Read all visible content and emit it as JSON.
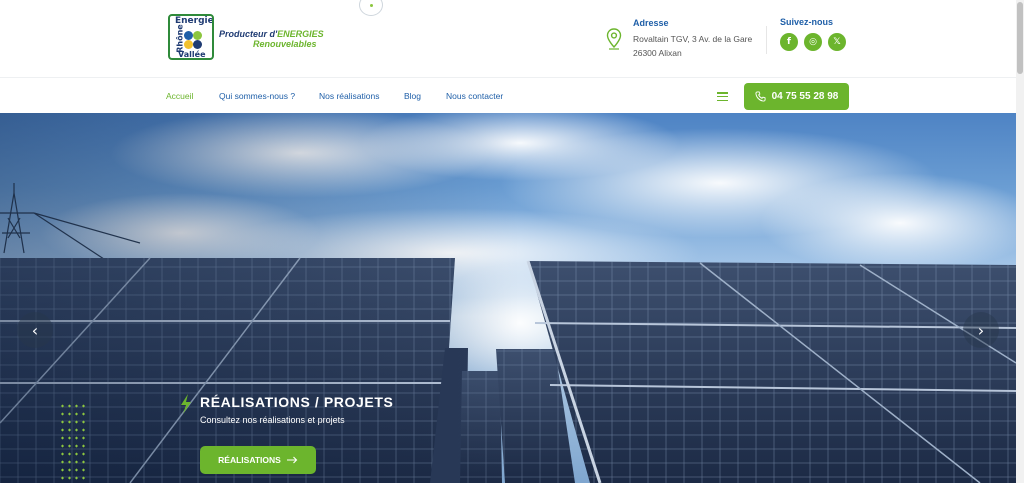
{
  "brand": {
    "logo_text_top": "Energie",
    "logo_text_side": "Rhône",
    "logo_text_bottom": "Vallée",
    "tagline_prefix": "Producteur d'",
    "tagline_accent": "ENERGIES",
    "tagline_line2": "Renouvelables",
    "colors": {
      "green": "#6cb52d",
      "blue": "#1f5fa8",
      "navy": "#1f3b73"
    }
  },
  "contact": {
    "address_title": "Adresse",
    "address_line1": "Rovaltain TGV, 3 Av. de la Gare",
    "address_line2": "26300 Alixan",
    "address_icon": "map-pin-icon",
    "follow_title": "Suivez-nous",
    "socials": [
      {
        "name": "facebook-icon",
        "glyph": "f"
      },
      {
        "name": "instagram-icon",
        "glyph": "◎"
      },
      {
        "name": "x-icon",
        "glyph": "𝕏"
      }
    ]
  },
  "nav": {
    "items": [
      "Accueil",
      "Qui sommes-nous ?",
      "Nos réalisations",
      "Blog",
      "Nous contacter"
    ],
    "active": "Accueil",
    "menu_icon": "hamburger-icon",
    "phone": "04 75 55 28 98",
    "phone_icon": "phone-icon"
  },
  "hero": {
    "title": "RÉALISATIONS / PROJETS",
    "subtitle": "Consultez nos réalisations et projets",
    "cta": "RÉALISATIONS",
    "prev_arrow": "‹",
    "next_arrow": "›"
  }
}
